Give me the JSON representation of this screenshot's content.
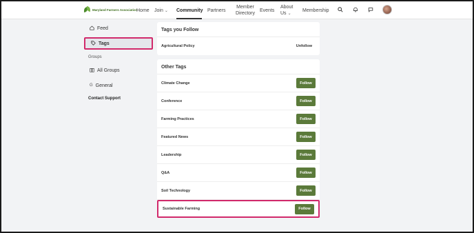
{
  "brand": {
    "name": "Maryland Farmers Association"
  },
  "nav": {
    "items": [
      {
        "label": "Home"
      },
      {
        "label": "Join",
        "has_caret": true
      },
      {
        "label": "Community",
        "active": true
      },
      {
        "label": "Partners"
      },
      {
        "label_line1": "Member",
        "label_line2": "Directory"
      },
      {
        "label": "Events"
      },
      {
        "label_line1": "About",
        "label_line2": "Us",
        "has_caret": true
      },
      {
        "label": "Membership"
      }
    ],
    "icons": [
      "search-icon",
      "bell-icon",
      "chat-icon"
    ]
  },
  "sidebar": {
    "feed": "Feed",
    "tags": "Tags",
    "groups_heading": "Groups",
    "all_groups": "All Groups",
    "general": "General",
    "contact_support": "Contact Support"
  },
  "followed": {
    "title": "Tags you Follow",
    "tags": [
      {
        "name": "Agricultural Policy",
        "action": "Unfollow"
      }
    ]
  },
  "other": {
    "title": "Other Tags",
    "tags": [
      {
        "name": "Climate Change",
        "action": "Follow"
      },
      {
        "name": "Conference",
        "action": "Follow"
      },
      {
        "name": "Farming Practices",
        "action": "Follow"
      },
      {
        "name": "Featured News",
        "action": "Follow"
      },
      {
        "name": "Leadership",
        "action": "Follow"
      },
      {
        "name": "Q&A",
        "action": "Follow"
      },
      {
        "name": "Soil Technology",
        "action": "Follow"
      },
      {
        "name": "Sustainable Farming",
        "action": "Follow"
      }
    ]
  },
  "colors": {
    "follow_button": "#5b7a3a",
    "highlight": "#d1286a",
    "brand_green": "#4a8a2a"
  }
}
